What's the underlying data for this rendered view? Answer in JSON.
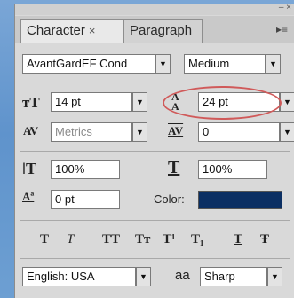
{
  "tabs": [
    {
      "label": "Character",
      "close": "×"
    },
    {
      "label": "Paragraph"
    }
  ],
  "font": {
    "family": "AvantGardEF Cond",
    "style": "Medium"
  },
  "size": {
    "value": "14 pt",
    "leading": "24 pt"
  },
  "kerning": {
    "value": "Metrics",
    "tracking": "0"
  },
  "scale": {
    "vertical": "100%",
    "horizontal": "100%"
  },
  "baseline": {
    "value": "0 pt"
  },
  "color": {
    "label": "Color:",
    "swatch": "#0b2f63"
  },
  "style_buttons": [
    "T",
    "T",
    "TT",
    "Tт",
    "T¹",
    "T₁",
    "T",
    "Ŧ"
  ],
  "language": {
    "value": "English: USA"
  },
  "antialias": {
    "icon": "aa",
    "value": "Sharp"
  },
  "icons": {
    "size": "font-size-icon",
    "leading": "leading-icon",
    "kerning": "kerning-icon",
    "tracking": "tracking-icon",
    "vscale": "vertical-scale-icon",
    "hscale": "horizontal-scale-icon",
    "baseline": "baseline-shift-icon"
  }
}
